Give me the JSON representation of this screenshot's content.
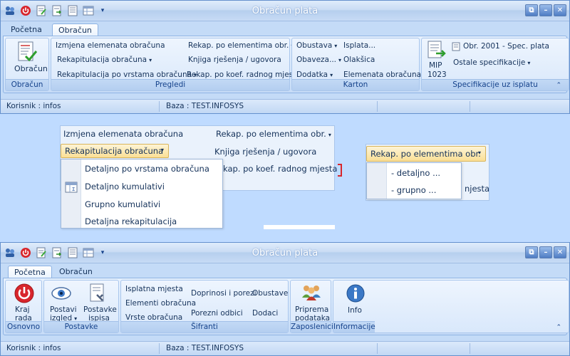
{
  "window_title": "Obračun plata",
  "colors": {
    "ribbon_bg": "#dbe9fb",
    "title_text": "#ffffff",
    "highlight": "#fbdf95",
    "close_red": "#d8262c"
  },
  "top": {
    "tabs": [
      "Početna",
      "Obračun"
    ],
    "active_tab": "Obračun",
    "groups": {
      "obracun": {
        "label": "Obračun",
        "button": "Obračun"
      },
      "pregledi": {
        "label": "Pregledi",
        "items": [
          "Izmjena elemenata obračuna",
          "Rekapitulacija obračuna",
          "Rekapitulacija po vrstama obračuna",
          "Rekap. po elementima obr.",
          "Knjiga rješenja / ugovora",
          "Rekap. po koef. radnog mjesta"
        ]
      },
      "karton": {
        "label": "Karton",
        "items": [
          "Obustava",
          "Obaveza...",
          "Dodatka",
          "Isplata...",
          "Olakšica",
          "Elemenata obračuna..."
        ]
      },
      "specifikacije": {
        "label": "Specifikacije uz isplatu",
        "mip_line1": "MIP",
        "mip_line2": "1023",
        "items": [
          "Obr. 2001 - Spec. plata",
          "Ostale specifikacije"
        ]
      }
    },
    "status": {
      "user": "Korisnik :  infos",
      "db": "Baza :  TEST.INFOSYS"
    }
  },
  "middle": {
    "left_panel": {
      "items": [
        "Izmjena elemenata obračuna",
        "Rekapitulacija obračuna",
        "Rekap. po elementima obr.",
        "Knjiga rješenja / ugovora",
        "kap. po koef. radnog mjesta"
      ],
      "dropdown": [
        "Detaljno po vrstama obračuna",
        "Detaljno  kumulativi",
        "Grupno kumulativi",
        "Detaljna rekapitulacija"
      ]
    },
    "right_panel": {
      "button": "Rekap. po elementima obr.",
      "dropdown": [
        "- detaljno ...",
        "- grupno ..."
      ],
      "behind_text": "njesta"
    }
  },
  "bottom": {
    "tabs": [
      "Početna",
      "Obračun"
    ],
    "active_tab": "Početna",
    "groups": {
      "osnovno": {
        "label": "Osnovno",
        "button_line1": "Kraj",
        "button_line2": "rada"
      },
      "postavke": {
        "label": "Postavke",
        "postavi_line1": "Postavi",
        "postavi_line2": "izgled",
        "ispis_line1": "Postavke",
        "ispis_line2": "ispisa"
      },
      "sifranti": {
        "label": "Šifranti",
        "items": [
          "Isplatna mjesta",
          "Elementi obračuna",
          "Vrste obračuna",
          "Doprinosi i porezi",
          "Porezni odbici",
          "Obustave",
          "Dodaci"
        ]
      },
      "zaposlenici": {
        "label": "Zaposlenici",
        "line1": "Priprema",
        "line2": "podataka"
      },
      "informacije": {
        "label": "Informacije",
        "button": "Info"
      }
    },
    "status": {
      "user": "Korisnik :  infos",
      "db": "Baza :  TEST.INFOSYS"
    }
  }
}
